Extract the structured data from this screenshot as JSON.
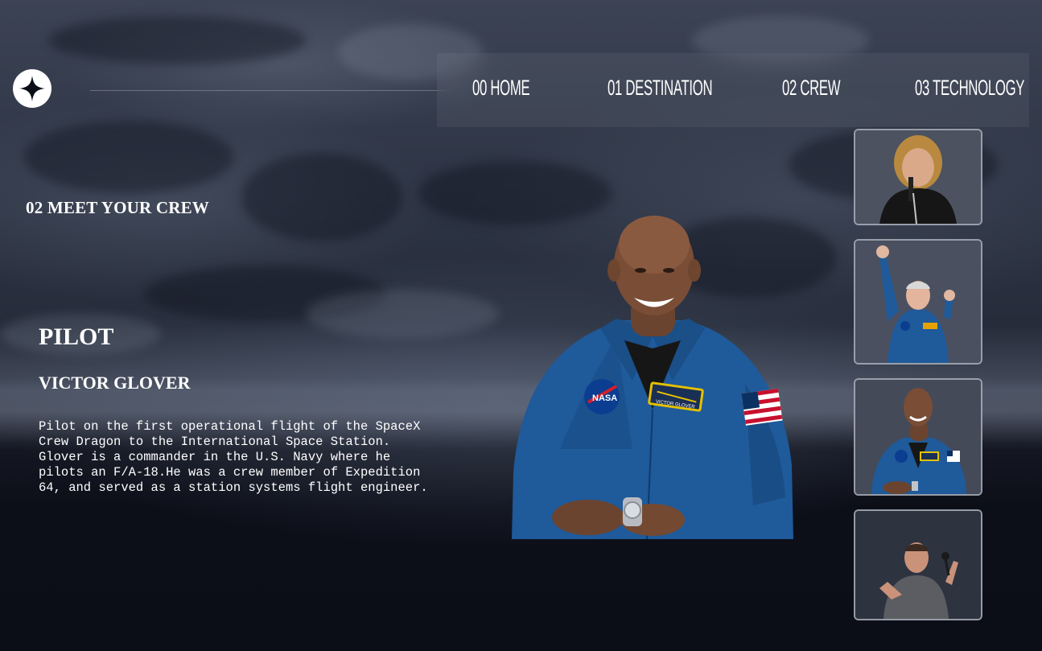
{
  "nav": {
    "items": [
      {
        "label": "00 HOME"
      },
      {
        "label": "01 DESTINATION"
      },
      {
        "label": "02 CREW"
      },
      {
        "label": "03 TECHNOLOGY"
      }
    ]
  },
  "page": {
    "title": "02 MEET YOUR CREW"
  },
  "crew_member": {
    "role": "PILOT",
    "name": "VICTOR GLOVER",
    "bio": "Pilot on the first operational flight of the SpaceX Crew Dragon to the International Space Station. Glover is a commander in the U.S. Navy where he pilots an F/A-18.He was a crew member of Expedition 64, and served as a station systems flight engineer.",
    "name_patch": "VICTOR GLOVER"
  },
  "colors": {
    "background": "#0b0d17",
    "text": "#ffffff",
    "suit_blue": "#1f5a9a"
  },
  "icons": {
    "logo": "star-logo-icon"
  }
}
